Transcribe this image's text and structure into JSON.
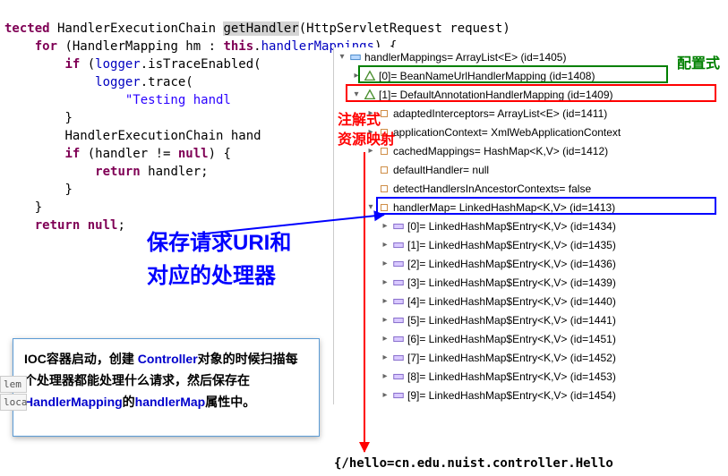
{
  "code": {
    "l1_a": "tected",
    "l1_b": " HandlerExecutionChain ",
    "l1_c": "getHandler",
    "l1_d": "(HttpServletRequest request) ",
    "l2_a": "for",
    "l2_b": " (HandlerMapping hm : ",
    "l2_c": "this",
    "l2_d": ".",
    "l2_e": "handlerMappings",
    "l2_f": ") {",
    "l3_a": "if",
    "l3_b": " (",
    "l3_c": "logger",
    "l3_d": ".isTraceEnabled(",
    "l4_a": "logger",
    "l4_b": ".trace(",
    "l5_a": "\"Testing handl",
    "l6": "}",
    "l7": "HandlerExecutionChain hand",
    "l8_a": "if",
    "l8_b": " (handler != ",
    "l8_c": "null",
    "l8_d": ") {",
    "l9_a": "return",
    "l9_b": " handler;",
    "l10": "}",
    "l11": "}",
    "l12_a": "return",
    "l12_b": " ",
    "l12_c": "null",
    "l12_d": ";"
  },
  "tree": {
    "r0": "handlerMappings= ArrayList<E>  (id=1405)",
    "r1": "[0]= BeanNameUrlHandlerMapping  (id=1408)",
    "r2": "[1]= DefaultAnnotationHandlerMapping  (id=1409)",
    "r3": "adaptedInterceptors= ArrayList<E>  (id=1411)",
    "r4": "applicationContext= XmlWebApplicationContext",
    "r5": "cachedMappings= HashMap<K,V>  (id=1412)",
    "r6": "defaultHandler= null",
    "r7": "detectHandlersInAncestorContexts= false",
    "r8": "handlerMap= LinkedHashMap<K,V>  (id=1413)",
    "r9": "[0]= LinkedHashMap$Entry<K,V>  (id=1434)",
    "r10": "[1]= LinkedHashMap$Entry<K,V>  (id=1435)",
    "r11": "[2]= LinkedHashMap$Entry<K,V>  (id=1436)",
    "r12": "[3]= LinkedHashMap$Entry<K,V>  (id=1439)",
    "r13": "[4]= LinkedHashMap$Entry<K,V>  (id=1440)",
    "r14": "[5]= LinkedHashMap$Entry<K,V>  (id=1441)",
    "r15": "[6]= LinkedHashMap$Entry<K,V>  (id=1451)",
    "r16": "[7]= LinkedHashMap$Entry<K,V>  (id=1452)",
    "r17": "[8]= LinkedHashMap$Entry<K,V>  (id=1453)",
    "r18": "[9]= LinkedHashMap$Entry<K,V>  (id=1454)"
  },
  "anno": {
    "green1": "配置式",
    "red1": "注解式",
    "red2": "资源映射",
    "blue1": "保存请求URI和",
    "blue2": "对应的处理器"
  },
  "tooltip": {
    "t1a": "IOC容器启动，创建 ",
    "t1b": "Controller",
    "t1c": "对象的时候扫描每个处理器都能处理什么请求，然后保存在",
    "t1d": "HandlerMapping",
    "t1e": "的",
    "t1f": "handlerMap",
    "t1g": "属性中。"
  },
  "bottom": "{/hello=cn.edu.nuist.controller.Hello",
  "tabs": {
    "a": "lem",
    "b": "loca"
  }
}
